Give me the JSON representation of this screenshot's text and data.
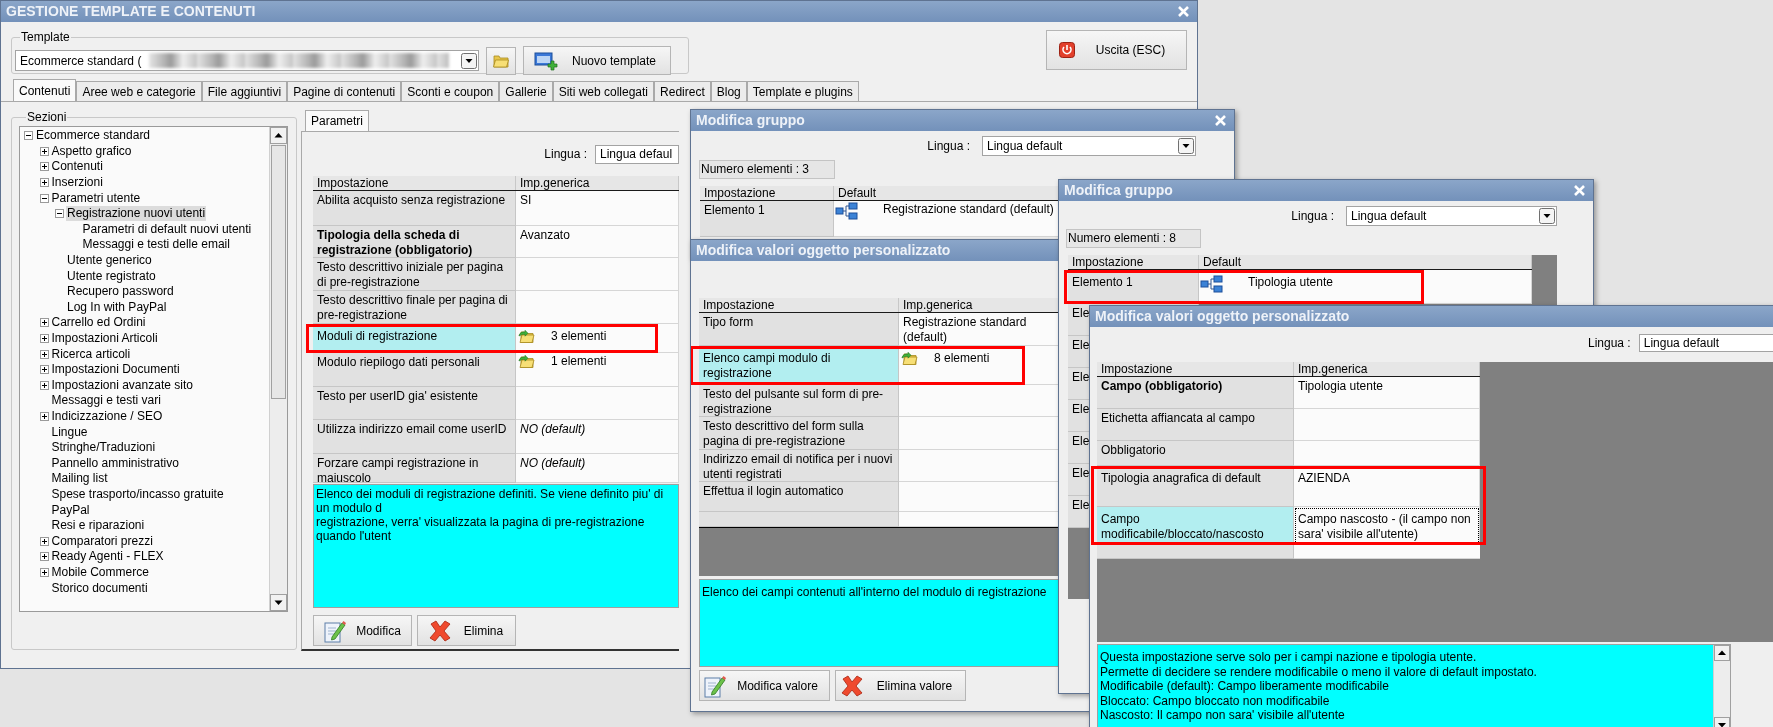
{
  "main_window": {
    "title": "GESTIONE TEMPLATE E CONTENUTI"
  },
  "template": {
    "label": "Template",
    "value": "Ecommerce standard (",
    "redacted": true
  },
  "new_template_button": "Nuovo template",
  "exit_button": "Uscita (ESC)",
  "tabs": [
    {
      "label": "Contenuti",
      "selected": true
    },
    {
      "label": "Aree web e categorie",
      "selected": false
    },
    {
      "label": "File aggiuntivi",
      "selected": false
    },
    {
      "label": "Pagine di contenuti",
      "selected": false
    },
    {
      "label": "Sconti e coupon",
      "selected": false
    },
    {
      "label": "Gallerie",
      "selected": false
    },
    {
      "label": "Siti web collegati",
      "selected": false
    },
    {
      "label": "Redirect",
      "selected": false
    },
    {
      "label": "Blog",
      "selected": false
    },
    {
      "label": "Template e plugins",
      "selected": false
    }
  ],
  "sections": {
    "label": "Sezioni",
    "tree": [
      {
        "label": "Ecommerce standard",
        "selected": false,
        "expanded": true,
        "children": [
          {
            "label": "Aspetto grafico",
            "selected": false,
            "expanded": false
          },
          {
            "label": "Contenuti",
            "selected": false,
            "expanded": false
          },
          {
            "label": "Inserzioni",
            "selected": false,
            "expanded": false
          },
          {
            "label": "Parametri utente",
            "selected": false,
            "expanded": true,
            "children": [
              {
                "label": "Registrazione nuovi utenti",
                "selected": true,
                "expanded": true,
                "children": [
                  {
                    "label": "Parametri di default nuovi utenti",
                    "selected": false
                  },
                  {
                    "label": "Messaggi e testi delle email",
                    "selected": false
                  }
                ]
              },
              {
                "label": "Utente generico",
                "selected": false
              },
              {
                "label": "Utente registrato",
                "selected": false
              },
              {
                "label": "Recupero password",
                "selected": false
              },
              {
                "label": "Log In with PayPal",
                "selected": false
              }
            ]
          },
          {
            "label": "Carrello ed Ordini",
            "selected": false,
            "expanded": false
          },
          {
            "label": "Impostazioni Articoli",
            "selected": false,
            "expanded": false
          },
          {
            "label": "Ricerca articoli",
            "selected": false,
            "expanded": false
          },
          {
            "label": "Impostazioni Documenti",
            "selected": false,
            "expanded": false
          },
          {
            "label": "Impostazioni avanzate sito",
            "selected": false,
            "expanded": false
          },
          {
            "label": "Messaggi e testi vari",
            "selected": false
          },
          {
            "label": "Indicizzazione / SEO",
            "selected": false,
            "expanded": false
          },
          {
            "label": "Lingue",
            "selected": false
          },
          {
            "label": "Stringhe/Traduzioni",
            "selected": false
          },
          {
            "label": "Pannello amministrativo",
            "selected": false
          },
          {
            "label": "Mailing list",
            "selected": false
          },
          {
            "label": "Spese trasporto/incasso gratuite",
            "selected": false
          },
          {
            "label": "PayPal",
            "selected": false
          },
          {
            "label": "Resi e riparazioni",
            "selected": false
          },
          {
            "label": "Comparatori prezzi",
            "selected": false,
            "expanded": false
          },
          {
            "label": "Ready Agenti - FLEX",
            "selected": false,
            "expanded": false
          },
          {
            "label": "Mobile Commerce",
            "selected": false,
            "expanded": false
          },
          {
            "label": "Storico documenti",
            "selected": false
          }
        ]
      }
    ]
  },
  "parameters": {
    "tab": {
      "label": "Parametri",
      "selected": true
    },
    "language_label": "Lingua :",
    "language": "Lingua defaul",
    "columns": [
      "Impostazione",
      "Imp.generica"
    ],
    "rows": [
      {
        "label": "Abilita acquisto senza registrazione",
        "required": false,
        "selected": false,
        "highlighted": false,
        "kind": "text",
        "value": "SI"
      },
      {
        "label": "Tipologia della scheda di registrazione (obbligatorio)",
        "required": true,
        "selected": false,
        "highlighted": false,
        "kind": "text",
        "value": "Avanzato"
      },
      {
        "label": "Testo descrittivo iniziale per pagina di pre-registrazione",
        "required": false,
        "selected": false,
        "highlighted": false,
        "kind": "text"
      },
      {
        "label": "Testo descrittivo finale per pagina di pre-registrazione",
        "required": false,
        "selected": false,
        "highlighted": false,
        "kind": "text"
      },
      {
        "label": "Moduli di registrazione",
        "required": false,
        "selected": true,
        "highlighted": true,
        "kind": "elements",
        "value": "3 elementi"
      },
      {
        "label": "Modulo riepilogo dati personali",
        "required": false,
        "selected": false,
        "highlighted": false,
        "kind": "elements",
        "value": "1 elementi"
      },
      {
        "label": "Testo per userID gia' esistente",
        "required": false,
        "selected": false,
        "highlighted": false,
        "kind": "text"
      },
      {
        "label": "Utilizza indirizzo email come userID",
        "required": false,
        "selected": false,
        "highlighted": false,
        "kind": "default",
        "value": "NO (default)"
      },
      {
        "label": "Forzare campi registrazione in maiuscolo",
        "required": false,
        "selected": false,
        "highlighted": false,
        "kind": "default",
        "value": "NO (default)"
      }
    ],
    "description": [
      "Elenco dei moduli di registrazione definiti. Se viene definito piu' di un modulo d",
      "registrazione, verra' visualizzata la pagina di pre-registrazione quando l'utent"
    ],
    "buttons": [
      "Modifica",
      "Elimina"
    ]
  },
  "group_dialog_1": {
    "title": "Modifica gruppo",
    "language_label": "Lingua :",
    "language": "Lingua default",
    "count": "Numero elementi : 3",
    "columns": [
      "Impostazione",
      "Default"
    ],
    "rows": [
      {
        "label": "Elemento 1",
        "value": "Registrazione standard (default)"
      }
    ]
  },
  "object_dialog_1": {
    "title": "Modifica valori oggetto personalizzato",
    "columns": [
      "Impostazione",
      "Imp.generica"
    ],
    "rows": [
      {
        "label": "Tipo form",
        "selected": false,
        "highlighted": false,
        "kind": "text",
        "value": "Registrazione standard (default)"
      },
      {
        "label": "Elenco campi modulo di registrazione",
        "selected": true,
        "highlighted": true,
        "kind": "elements",
        "value": "8 elementi"
      },
      {
        "label": "Testo del pulsante sul form di pre-registrazione",
        "selected": false,
        "highlighted": false,
        "kind": "text"
      },
      {
        "label": "Testo descrittivo del form sulla pagina di pre-registrazione",
        "selected": false,
        "highlighted": false,
        "kind": "text"
      },
      {
        "label": "Indirizzo email di notifica per i nuovi utenti registrati",
        "selected": false,
        "highlighted": false,
        "kind": "text"
      },
      {
        "label": "Effettua il login automatico",
        "selected": false,
        "highlighted": false,
        "kind": "text"
      }
    ],
    "description": "Elenco dei campi contenuti all'interno del modulo di registrazione",
    "buttons": [
      "Modifica valore",
      "Elimina valore"
    ]
  },
  "group_dialog_2": {
    "title": "Modifica gruppo",
    "language_label": "Lingua :",
    "language": "Lingua default",
    "count": "Numero elementi : 8",
    "columns": [
      "Impostazione",
      "Default"
    ],
    "rows": [
      {
        "label": "Elemento 1",
        "highlighted": true,
        "value": "Tipologia utente"
      },
      {
        "label": "Ele",
        "highlighted": false
      },
      {
        "label": "Ele",
        "highlighted": false
      },
      {
        "label": "Ele",
        "highlighted": false
      },
      {
        "label": "Ele",
        "highlighted": false
      },
      {
        "label": "Ele",
        "highlighted": false
      },
      {
        "label": "Ele",
        "highlighted": false
      },
      {
        "label": "Ele",
        "highlighted": false
      }
    ]
  },
  "object_dialog_2": {
    "title": "Modifica valori oggetto personalizzato",
    "language_label": "Lingua :",
    "language": "Lingua default",
    "columns": [
      "Impostazione",
      "Imp.generica"
    ],
    "rows": [
      {
        "label": "Campo (obbligatorio)",
        "required": true,
        "selected": false,
        "highlighted": false,
        "focused": false,
        "value": "Tipologia utente"
      },
      {
        "label": "Etichetta affiancata al campo",
        "required": false,
        "selected": false,
        "highlighted": false,
        "focused": false
      },
      {
        "label": "Obbligatorio",
        "required": false,
        "selected": false,
        "highlighted": false,
        "focused": false
      },
      {
        "label": "Tipologia anagrafica di default",
        "required": false,
        "selected": false,
        "highlighted": true,
        "focused": false,
        "value": "AZIENDA"
      },
      {
        "label": "Campo modificabile/bloccato/nascosto",
        "required": false,
        "selected": true,
        "highlighted": true,
        "focused": true,
        "value": "Campo nascosto - (il campo non sara' visibile all'utente)"
      }
    ],
    "description": [
      "Questa impostazione serve solo per i campi nazione e tipologia utente.",
      "Permette di decidere se rendere modificabile o meno il valore di default impostato.",
      "Modificabile (default): Campo liberamente modificabile",
      "Bloccato: Campo bloccato non modificabile",
      "Nascosto: Il campo non sara' visibile all'utente"
    ]
  }
}
